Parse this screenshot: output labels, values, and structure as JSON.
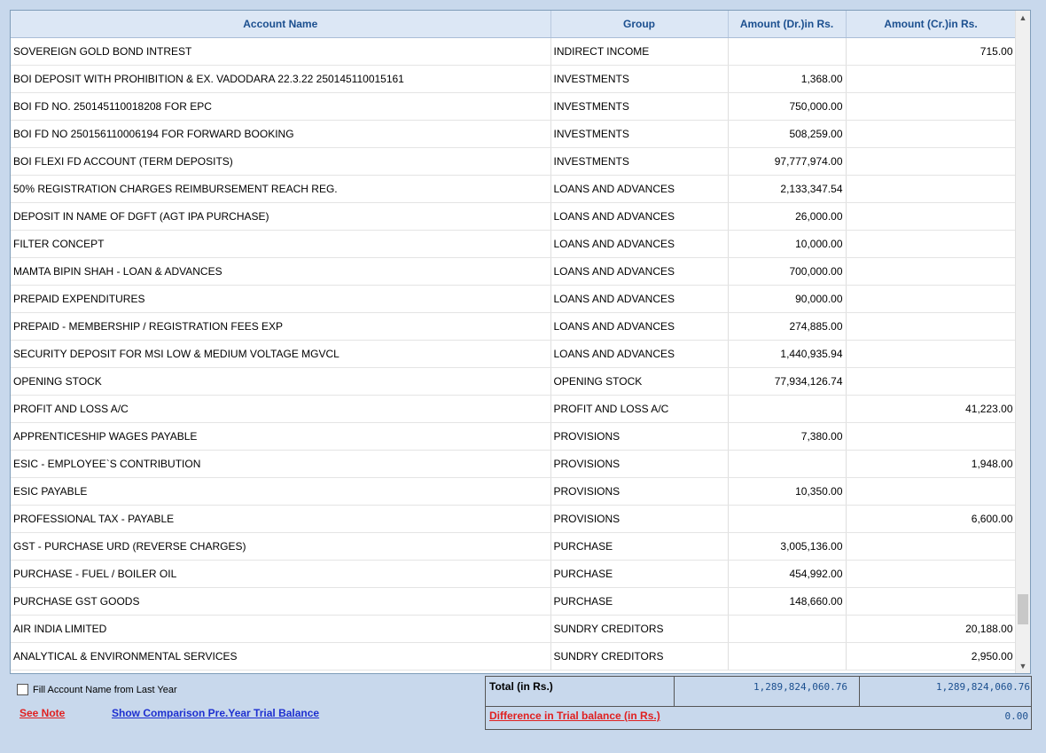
{
  "table": {
    "headers": [
      "Account Name",
      "Group",
      "Amount (Dr.)in Rs.",
      "Amount (Cr.)in Rs."
    ],
    "rows": [
      [
        "SOVEREIGN GOLD BOND INTREST",
        "INDIRECT INCOME",
        "",
        "715.00"
      ],
      [
        "BOI DEPOSIT WITH PROHIBITION & EX. VADODARA 22.3.22 250145110015161",
        "INVESTMENTS",
        "1,368.00",
        ""
      ],
      [
        "BOI FD NO. 250145110018208 FOR EPC",
        "INVESTMENTS",
        "750,000.00",
        ""
      ],
      [
        "BOI FD NO 250156110006194 FOR FORWARD BOOKING",
        "INVESTMENTS",
        "508,259.00",
        ""
      ],
      [
        "BOI FLEXI FD ACCOUNT (TERM DEPOSITS)",
        "INVESTMENTS",
        "97,777,974.00",
        ""
      ],
      [
        "50% REGISTRATION CHARGES REIMBURSEMENT REACH REG.",
        "LOANS AND ADVANCES",
        "2,133,347.54",
        ""
      ],
      [
        "DEPOSIT IN NAME OF DGFT (AGT IPA PURCHASE)",
        "LOANS AND ADVANCES",
        "26,000.00",
        ""
      ],
      [
        "FILTER  CONCEPT",
        "LOANS AND ADVANCES",
        "10,000.00",
        ""
      ],
      [
        "MAMTA BIPIN SHAH - LOAN & ADVANCES",
        "LOANS AND ADVANCES",
        "700,000.00",
        ""
      ],
      [
        "PREPAID EXPENDITURES",
        "LOANS AND ADVANCES",
        "90,000.00",
        ""
      ],
      [
        "PREPAID - MEMBERSHIP / REGISTRATION FEES EXP",
        "LOANS AND ADVANCES",
        "274,885.00",
        ""
      ],
      [
        "SECURITY DEPOSIT FOR MSI LOW & MEDIUM VOLTAGE MGVCL",
        "LOANS AND ADVANCES",
        "1,440,935.94",
        ""
      ],
      [
        "OPENING STOCK",
        "OPENING STOCK",
        "77,934,126.74",
        ""
      ],
      [
        "PROFIT AND LOSS A/C",
        "PROFIT AND LOSS A/C",
        "",
        "41,223.00"
      ],
      [
        "APPRENTICESHIP WAGES PAYABLE",
        "PROVISIONS",
        "7,380.00",
        ""
      ],
      [
        "ESIC - EMPLOYEE`S CONTRIBUTION",
        "PROVISIONS",
        "",
        "1,948.00"
      ],
      [
        "ESIC PAYABLE",
        "PROVISIONS",
        "10,350.00",
        ""
      ],
      [
        "PROFESSIONAL TAX - PAYABLE",
        "PROVISIONS",
        "",
        "6,600.00"
      ],
      [
        "GST - PURCHASE URD (REVERSE CHARGES)",
        "PURCHASE",
        "3,005,136.00",
        ""
      ],
      [
        "PURCHASE - FUEL / BOILER OIL",
        "PURCHASE",
        "454,992.00",
        ""
      ],
      [
        "PURCHASE GST GOODS",
        "PURCHASE",
        "148,660.00",
        ""
      ],
      [
        "AIR INDIA LIMITED",
        "SUNDRY CREDITORS",
        "",
        "20,188.00"
      ],
      [
        "ANALYTICAL & ENVIRONMENTAL SERVICES",
        "SUNDRY CREDITORS",
        "",
        "2,950.00"
      ]
    ]
  },
  "footer": {
    "checkbox_label": "Fill Account Name from Last Year",
    "see_note": "See Note",
    "show_comparison": "Show Comparison Pre.Year Trial Balance",
    "total_label": "Total (in Rs.)",
    "total_dr": "1,289,824,060.76",
    "total_cr": "1,289,824,060.76",
    "difference_label": "Difference in Trial balance (in Rs.)",
    "difference_value": "0.00"
  },
  "icons": {
    "scroll_up": "chevron-up-icon",
    "scroll_down": "chevron-down-icon"
  }
}
